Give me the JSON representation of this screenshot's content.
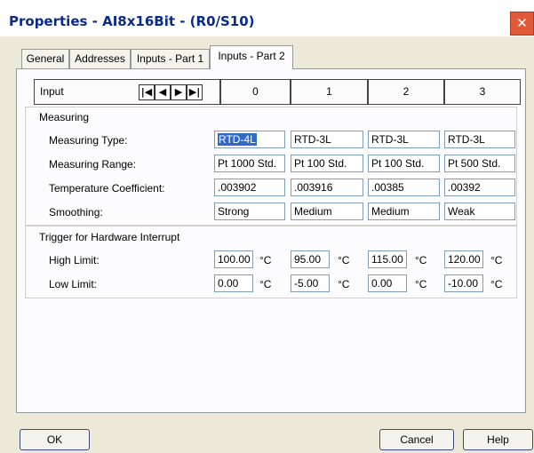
{
  "window": {
    "title": "Properties - AI8x16Bit - (R0/S10)",
    "close_glyph": "✕"
  },
  "tabs": [
    {
      "label": "General",
      "active": false
    },
    {
      "label": "Addresses",
      "active": false
    },
    {
      "label": "Inputs - Part 1",
      "active": false
    },
    {
      "label": "Inputs - Part 2",
      "active": true
    }
  ],
  "header": {
    "input_label": "Input",
    "nav": [
      "|◀",
      "◀",
      "▶",
      "▶|"
    ],
    "columns": [
      "0",
      "1",
      "2",
      "3"
    ]
  },
  "measuring": {
    "group_label": "Measuring",
    "rows": [
      {
        "label": "Measuring Type:",
        "values": [
          "RTD-4L",
          "RTD-3L",
          "RTD-3L",
          "RTD-3L"
        ]
      },
      {
        "label": "Measuring Range:",
        "values": [
          "Pt 1000 Std.",
          "Pt 100 Std.",
          "Pt 100 Std.",
          "Pt 500 Std."
        ]
      },
      {
        "label": "Temperature Coefficient:",
        "values": [
          ".003902",
          ".003916",
          ".00385",
          ".00392"
        ]
      },
      {
        "label": "Smoothing:",
        "values": [
          "Strong",
          "Medium",
          "Medium",
          "Weak"
        ]
      }
    ]
  },
  "trigger": {
    "group_label": "Trigger for Hardware Interrupt",
    "unit": "°C",
    "rows": [
      {
        "label": "High Limit:",
        "values": [
          "100.00",
          "95.00",
          "115.00",
          "120.00"
        ]
      },
      {
        "label": "Low Limit:",
        "values": [
          "0.00",
          "-5.00",
          "0.00",
          "-10.00"
        ]
      }
    ]
  },
  "buttons": {
    "ok": "OK",
    "cancel": "Cancel",
    "help": "Help"
  },
  "colors": {
    "title_text": "#0a2a8c",
    "close_button": "#e05a3a",
    "selection": "#316ac5",
    "dialog_background": "#ece9d8"
  }
}
